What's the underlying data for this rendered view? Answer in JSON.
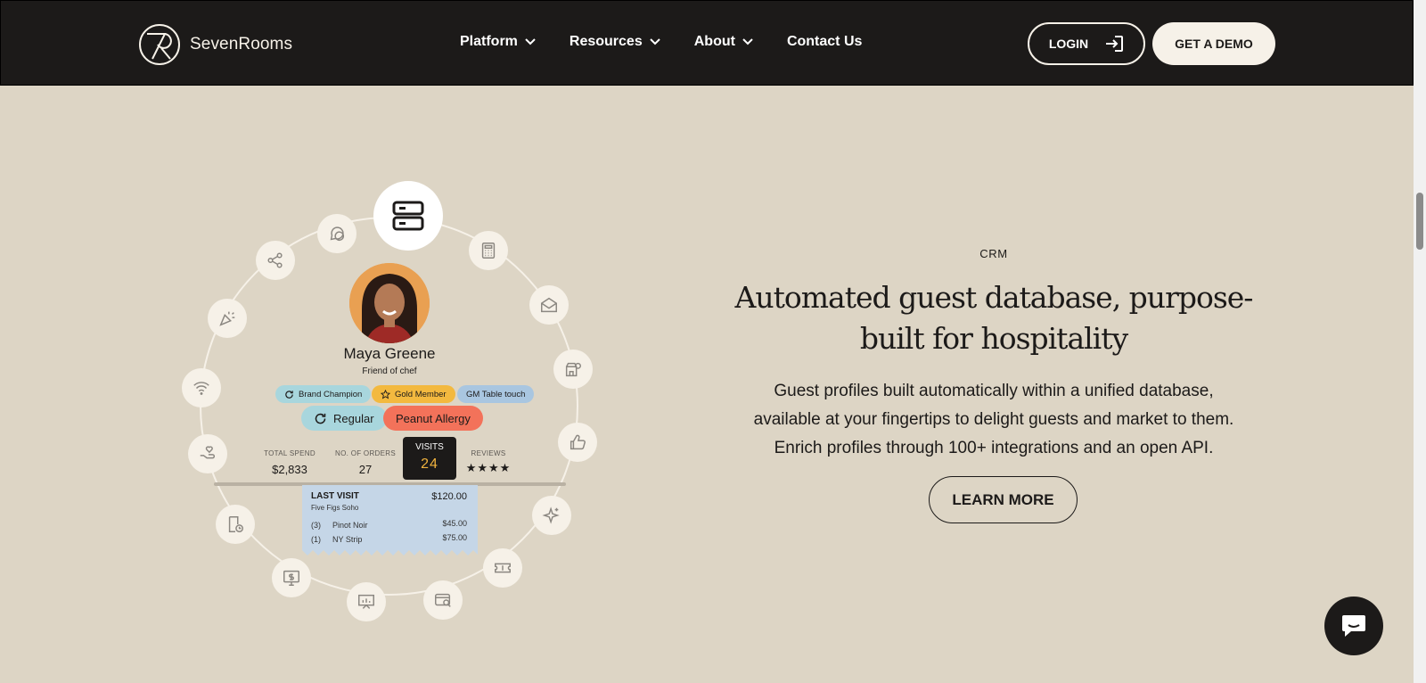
{
  "header": {
    "brand": "SevenRooms",
    "nav": [
      {
        "label": "Platform",
        "has_menu": true
      },
      {
        "label": "Resources",
        "has_menu": true
      },
      {
        "label": "About",
        "has_menu": true
      },
      {
        "label": "Contact Us",
        "has_menu": false
      }
    ],
    "login_label": "LOGIN",
    "demo_label": "GET A DEMO"
  },
  "profile": {
    "name": "Maya Greene",
    "subtitle": "Friend of chef",
    "tags": [
      "Brand Champion",
      "Gold Member",
      "GM Table touch"
    ],
    "big_tags": [
      "Regular",
      "Peanut Allergy"
    ],
    "stats": {
      "total_spend_label": "TOTAL SPEND",
      "total_spend": "$2,833",
      "orders_label": "NO. OF ORDERS",
      "orders": "27",
      "visits_label": "VISITS",
      "visits": "24",
      "reviews_label": "REVIEWS",
      "reviews_stars": 4
    },
    "receipt": {
      "title": "LAST VISIT",
      "venue": "Five Figs Soho",
      "total": "$120.00",
      "items": [
        {
          "qty": "(3)",
          "name": "Pinot Noir",
          "price": "$45.00"
        },
        {
          "qty": "(1)",
          "name": "NY Strip",
          "price": "$75.00"
        }
      ]
    }
  },
  "section": {
    "kicker": "CRM",
    "headline_line1": "Automated guest database, purpose-",
    "headline_line2": "built for hospitality",
    "body_line1": "Guest profiles built automatically within a unified database,",
    "body_line2": "available at your fingertips to delight guests and market to them.",
    "body_line3": "Enrich profiles through 100+ integrations and an open API.",
    "cta": "LEARN MORE"
  },
  "icons": [
    "database-icon",
    "chat-bubble-icon",
    "share-icon",
    "party-popper-icon",
    "wifi-icon",
    "hand-heart-icon",
    "clock-receipt-icon",
    "dollar-screen-icon",
    "presentation-icon",
    "card-search-icon",
    "ticket-icon",
    "sparkle-icon",
    "thumbs-up-icon",
    "store-icon",
    "mail-icon",
    "calculator-icon"
  ],
  "colors": {
    "header_bg": "#1c1a19",
    "page_bg": "#ddd5c5",
    "cream": "#f6f1e8",
    "allergy": "#f3725a",
    "gold": "#f3b93f",
    "receipt": "#c5d6e7"
  }
}
